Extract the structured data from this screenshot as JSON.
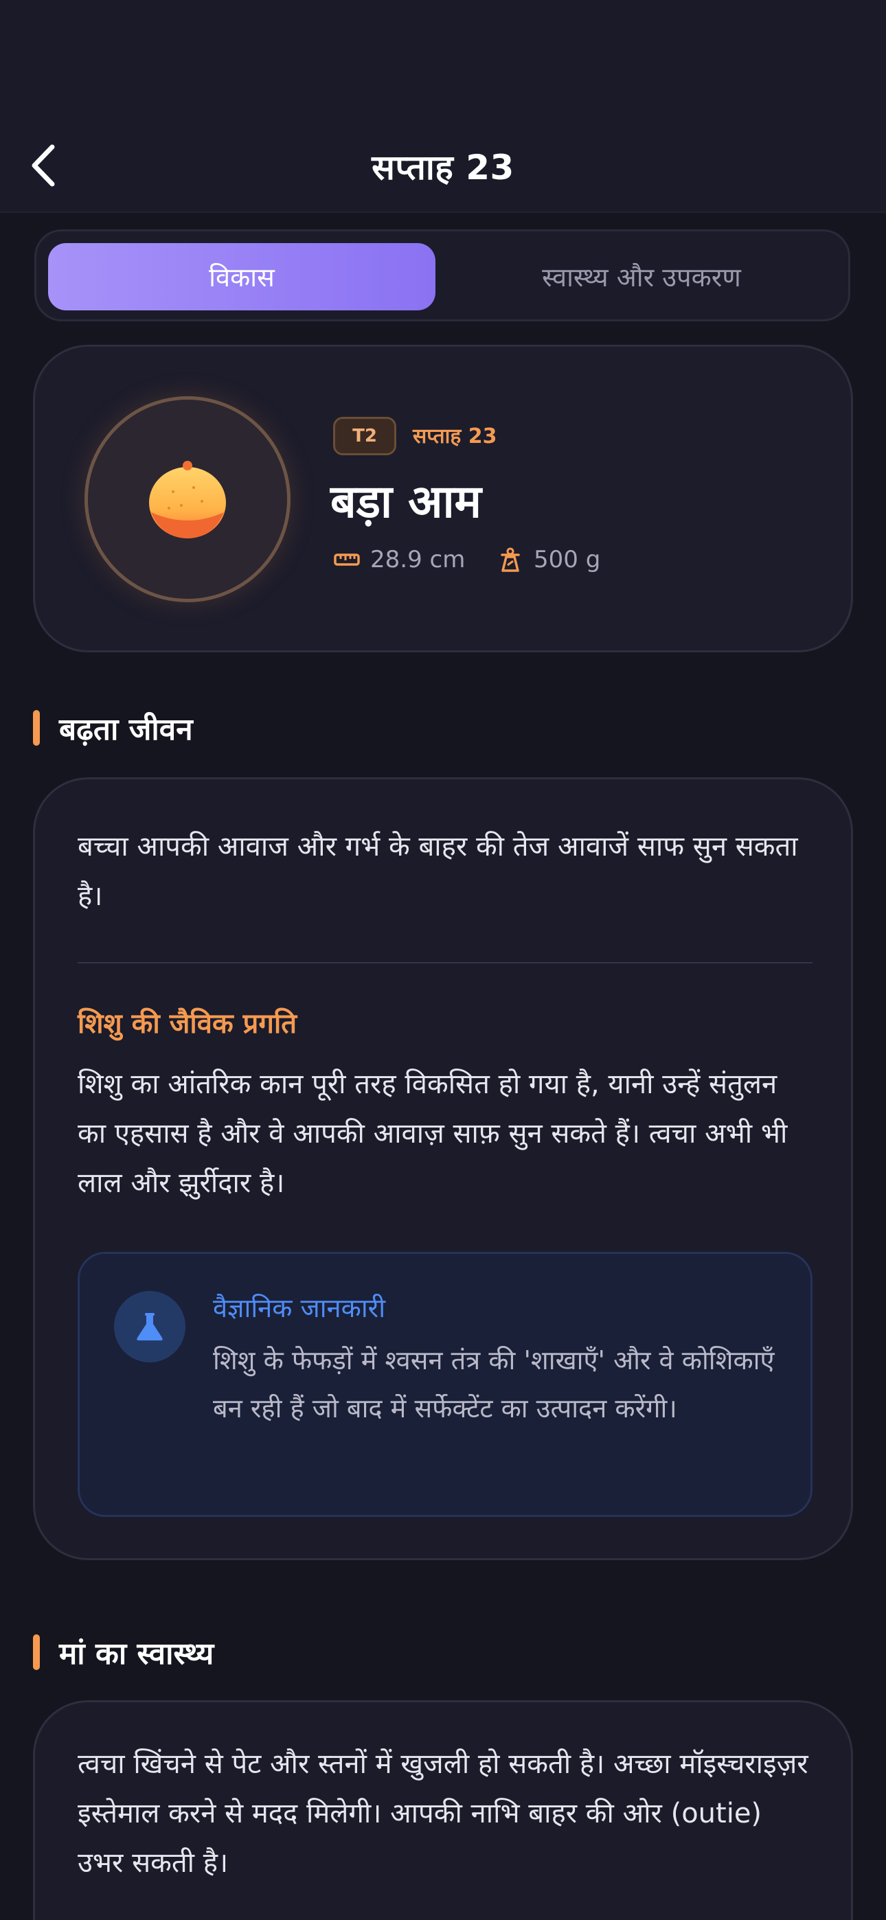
{
  "header": {
    "title": "सप्ताह 23",
    "back_icon": "chevron-left-icon"
  },
  "tabs": [
    {
      "label": "विकास",
      "active": true
    },
    {
      "label": "स्वास्थ्य और उपकरण",
      "active": false
    }
  ],
  "hero": {
    "trimester_badge": "T2",
    "week_label": "सप्ताह 23",
    "fruit_name": "बड़ा आम",
    "fruit_icon": "mango-icon",
    "length": "28.9 cm",
    "length_icon": "ruler-icon",
    "weight": "500 g",
    "weight_icon": "scale-icon"
  },
  "growing_life": {
    "heading": "बढ़ता जीवन",
    "summary": "बच्चा आपकी आवाज और गर्भ के बाहर की तेज आवाजें साफ सुन सकता है।",
    "progress_heading": "शिशु की जैविक प्रगति",
    "progress_text": "शिशु का आंतरिक कान पूरी तरह विकसित हो गया है, यानी उन्हें संतुलन का एहसास है और वे आपकी आवाज़ साफ़ सुन सकते हैं। त्वचा अभी भी लाल और झुर्रीदार है।",
    "science": {
      "icon": "flask-icon",
      "title": "वैज्ञानिक जानकारी",
      "text": "शिशु के फेफड़ों में श्वसन तंत्र की 'शाखाएँ' और वे कोशिकाएँ बन रही हैं जो बाद में सर्फेक्टेंट का उत्पादन करेंगी।"
    }
  },
  "mother_health": {
    "heading": "मां का स्वास्थ्य",
    "text": "त्वचा खिंचने से पेट और स्तनों में खुजली हो सकती है। अच्छा मॉइस्चराइज़र इस्तेमाल करने से मदद मिलेगी। आपकी नाभि बाहर की ओर (outie) उभर सकती है।"
  },
  "colors": {
    "background": "#15151f",
    "accent_orange": "#f59a50",
    "accent_purple": "#9b83f6",
    "science_blue": "#4f8df7"
  }
}
